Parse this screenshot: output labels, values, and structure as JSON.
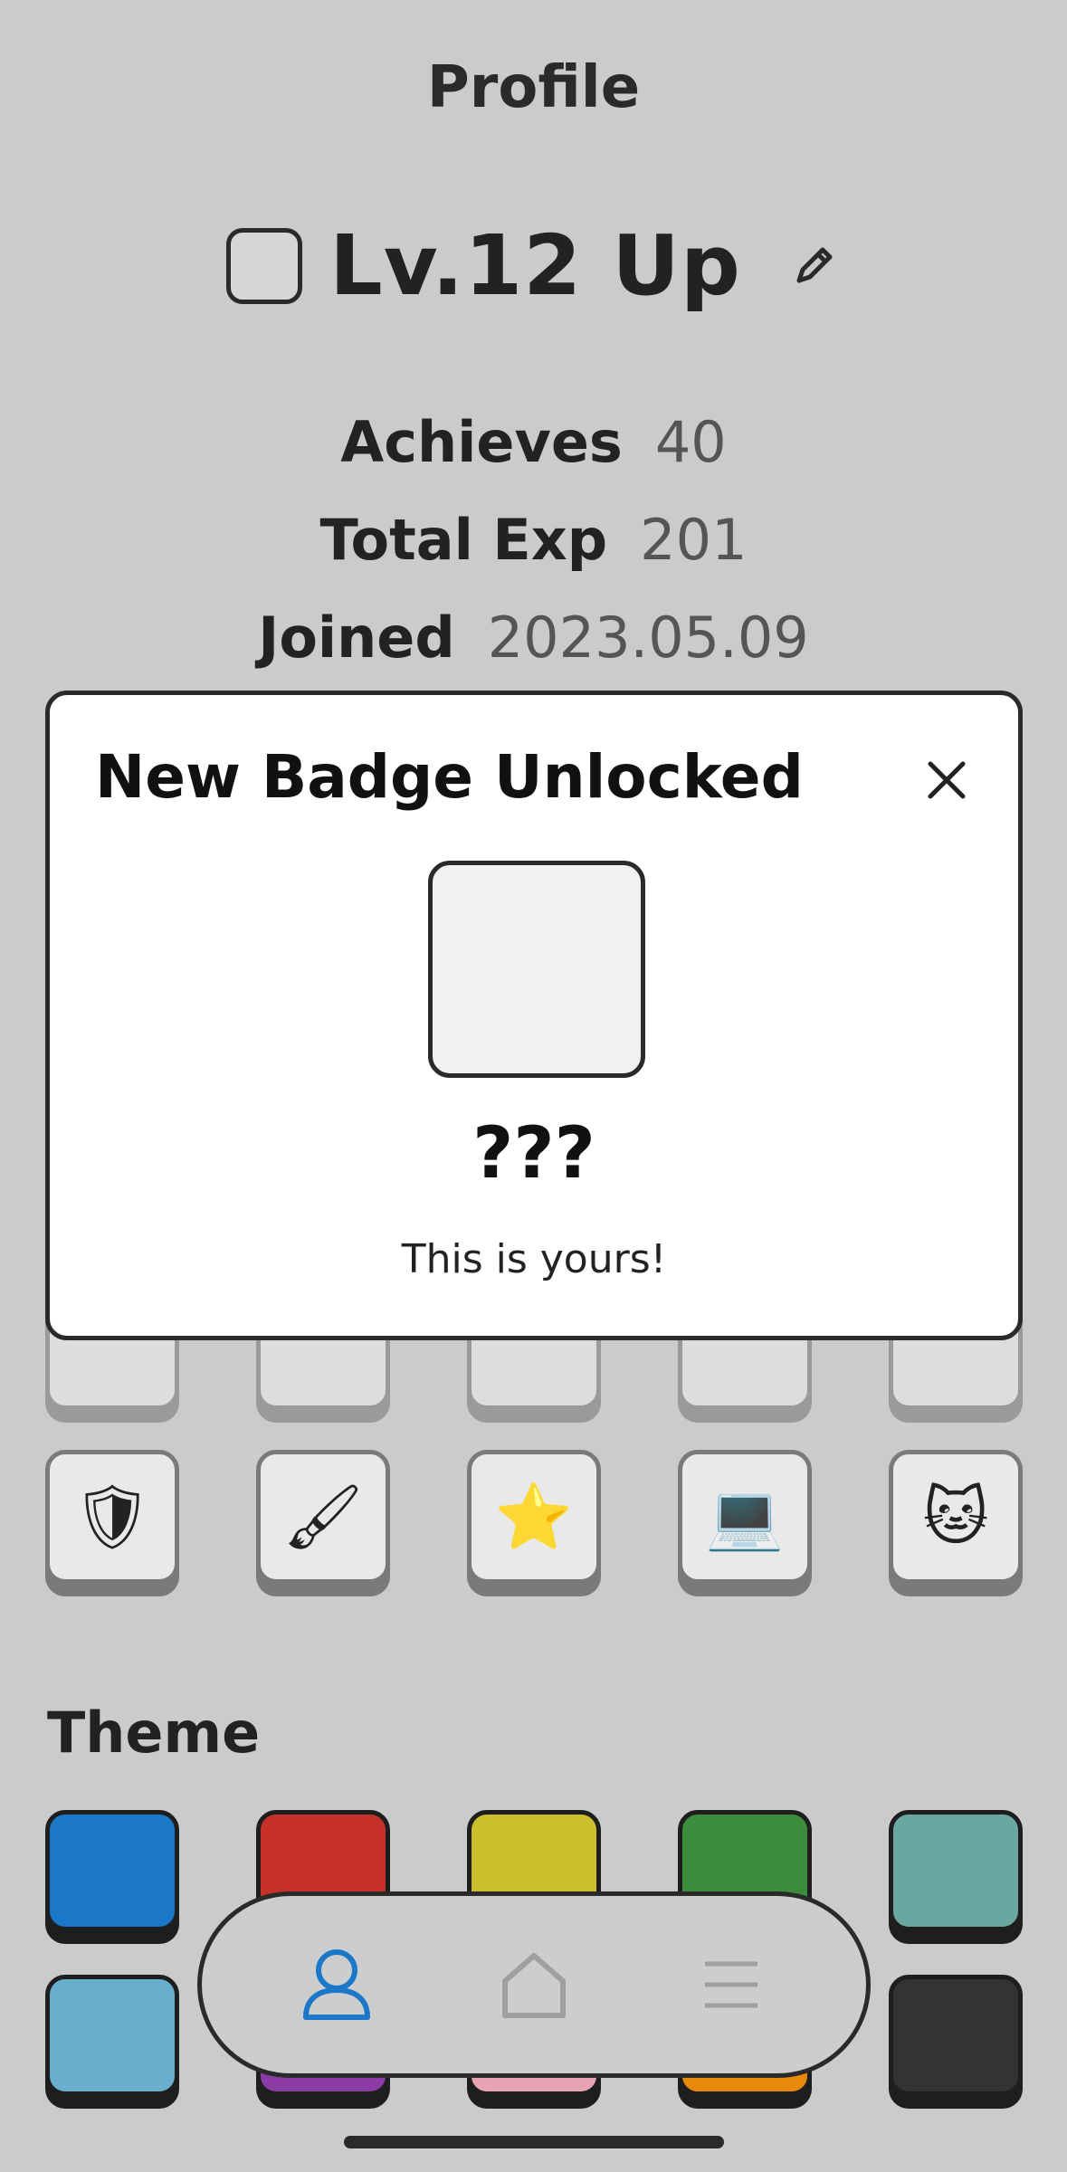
{
  "header": {
    "title": "Profile"
  },
  "level": {
    "text": "Lv.12 Up"
  },
  "stats": [
    {
      "label": "Achieves",
      "value": "40"
    },
    {
      "label": "Total Exp",
      "value": "201"
    },
    {
      "label": "Joined",
      "value": "2023.05.09"
    }
  ],
  "badges": {
    "row1_icons": [
      "stars-jar-icon",
      "colorful-stars-icon",
      "ribbon-medal-icon",
      "silver-shield-icon",
      "gold-medal-icon"
    ],
    "row2_icons": [
      "blue-star-crest-icon",
      "magic-brush-icon",
      "cool-star-icon",
      "hacker-laptop-icon",
      "cool-cat-icon"
    ],
    "row2_glyphs": [
      "🛡",
      "🖌",
      "⭐",
      "💻",
      "🐱"
    ]
  },
  "theme": {
    "title": "Theme",
    "colors_row1": [
      "#1b78c8",
      "#c63229",
      "#ccbf2d",
      "#3b8d3b",
      "#68a8a0"
    ],
    "colors_row2": [
      "#6aaecd",
      "#8a3ba6",
      "#e7a2b4",
      "#e8890a",
      "#333333"
    ]
  },
  "modal": {
    "title": "New Badge Unlocked",
    "badge_name": "???",
    "description": "This is yours!",
    "close_icon": "close-icon"
  },
  "nav": {
    "items": [
      {
        "icon": "profile-icon",
        "active": true,
        "color": "#1b78c8"
      },
      {
        "icon": "home-icon",
        "active": false,
        "color": "#a0a0a0"
      },
      {
        "icon": "menu-icon",
        "active": false,
        "color": "#a0a0a0"
      }
    ]
  }
}
